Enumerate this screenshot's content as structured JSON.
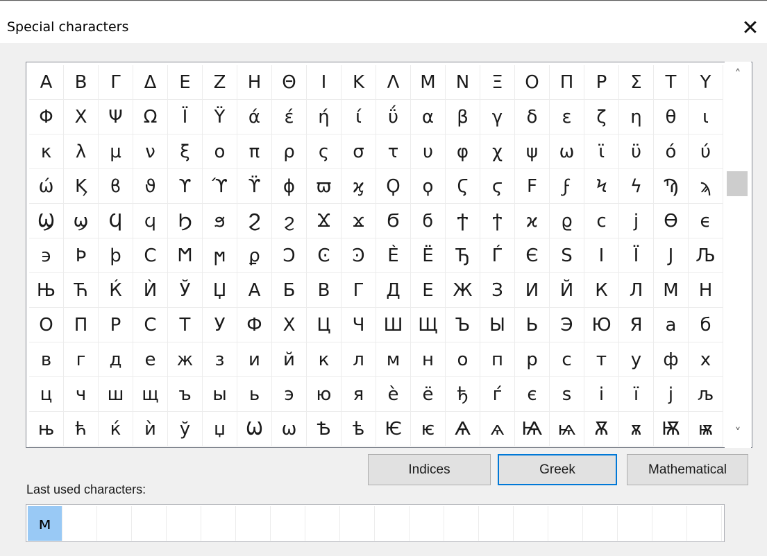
{
  "window": {
    "title": "Special characters",
    "close_glyph": "✕"
  },
  "characters": [
    "Α",
    "Β",
    "Γ",
    "Δ",
    "Ε",
    "Ζ",
    "Η",
    "Θ",
    "Ι",
    "Κ",
    "Λ",
    "Μ",
    "Ν",
    "Ξ",
    "Ο",
    "Π",
    "Ρ",
    "Σ",
    "Τ",
    "Υ",
    "Φ",
    "Χ",
    "Ψ",
    "Ω",
    "Ϊ",
    "Ϋ",
    "ά",
    "έ",
    "ή",
    "ί",
    "ΰ",
    "α",
    "β",
    "γ",
    "δ",
    "ε",
    "ζ",
    "η",
    "θ",
    "ι",
    "κ",
    "λ",
    "μ",
    "ν",
    "ξ",
    "ο",
    "π",
    "ρ",
    "ς",
    "σ",
    "τ",
    "υ",
    "φ",
    "χ",
    "ψ",
    "ω",
    "ϊ",
    "ϋ",
    "ό",
    "ύ",
    "ώ",
    "Ϗ",
    "ϐ",
    "ϑ",
    "ϒ",
    "ϓ",
    "ϔ",
    "ϕ",
    "ϖ",
    "ϗ",
    "Ϙ",
    "ϙ",
    "Ϛ",
    "ϛ",
    "Ϝ",
    "ϝ",
    "Ϟ",
    "ϟ",
    "Ϡ",
    "ϡ",
    "Ϣ",
    "ϣ",
    "Ϥ",
    "ϥ",
    "Ϧ",
    "ϧ",
    "Ϩ",
    "ϩ",
    "Ϫ",
    "ϫ",
    "Ϭ",
    "ϭ",
    "Ϯ",
    "ϯ",
    "ϰ",
    "ϱ",
    "ϲ",
    "ϳ",
    "ϴ",
    "ϵ",
    "϶",
    "Ϸ",
    "ϸ",
    "Ϲ",
    "Ϻ",
    "ϻ",
    "ϼ",
    "Ͻ",
    "Ͼ",
    "Ͽ",
    "Ѐ",
    "Ё",
    "Ђ",
    "Ѓ",
    "Є",
    "Ѕ",
    "І",
    "Ї",
    "Ј",
    "Љ",
    "Њ",
    "Ћ",
    "Ќ",
    "Ѝ",
    "Ў",
    "Џ",
    "А",
    "Б",
    "В",
    "Г",
    "Д",
    "Е",
    "Ж",
    "З",
    "И",
    "Й",
    "К",
    "Л",
    "М",
    "Н",
    "О",
    "П",
    "Р",
    "С",
    "Т",
    "У",
    "Ф",
    "Х",
    "Ц",
    "Ч",
    "Ш",
    "Щ",
    "Ъ",
    "Ы",
    "Ь",
    "Э",
    "Ю",
    "Я",
    "а",
    "б",
    "в",
    "г",
    "д",
    "е",
    "ж",
    "з",
    "и",
    "й",
    "к",
    "л",
    "м",
    "н",
    "о",
    "п",
    "р",
    "с",
    "т",
    "у",
    "ф",
    "х",
    "ц",
    "ч",
    "ш",
    "щ",
    "ъ",
    "ы",
    "ь",
    "э",
    "ю",
    "я",
    "ѐ",
    "ё",
    "ђ",
    "ѓ",
    "є",
    "ѕ",
    "і",
    "ї",
    "ј",
    "љ",
    "њ",
    "ћ",
    "ќ",
    "ѝ",
    "ў",
    "џ",
    "Ѡ",
    "ѡ",
    "Ѣ",
    "ѣ",
    "Ѥ",
    "ѥ",
    "Ѧ",
    "ѧ",
    "Ѩ",
    "ѩ",
    "Ѫ",
    "ѫ",
    "Ѭ",
    "ѭ"
  ],
  "scrollbar": {
    "up_glyph": "˄",
    "down_glyph": "˅"
  },
  "buttons": {
    "indices": "Indices",
    "greek": "Greek",
    "mathematical": "Mathematical"
  },
  "last_used": {
    "label": "Last used characters:",
    "characters": [
      "м"
    ]
  }
}
